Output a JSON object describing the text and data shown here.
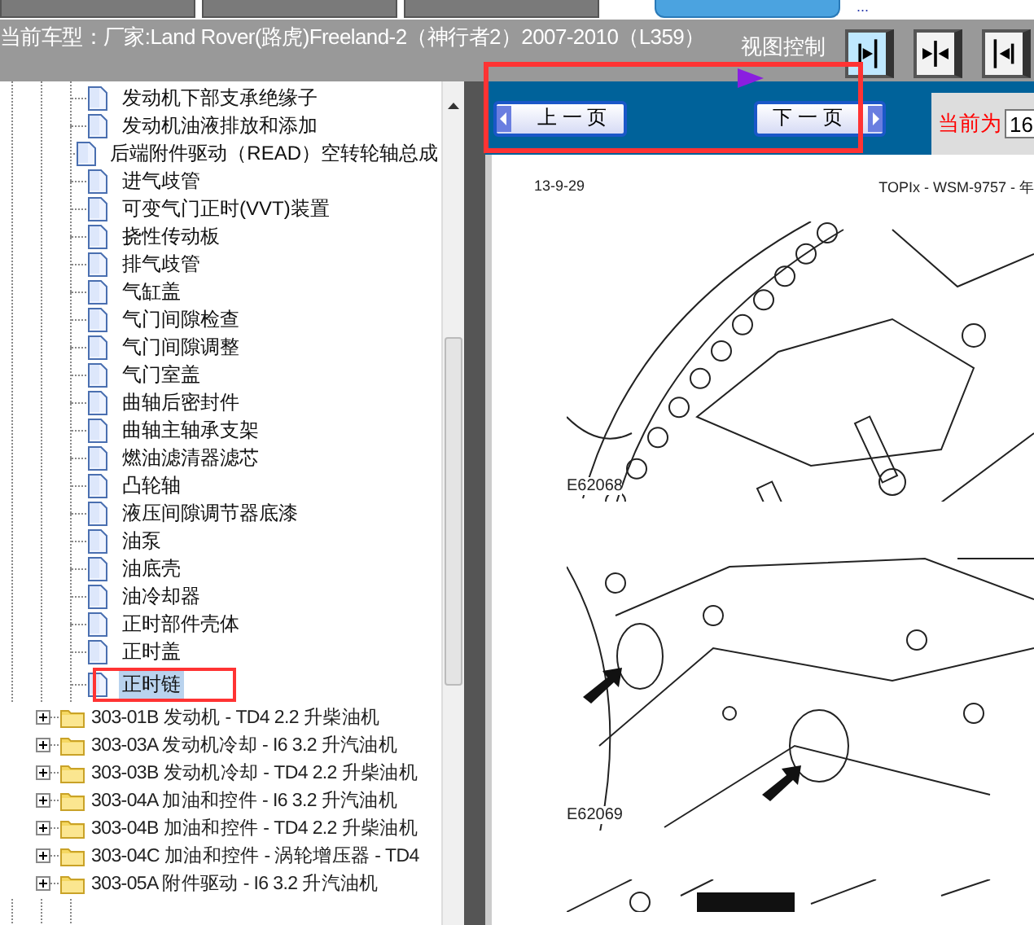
{
  "top_toolbar": {
    "buttons": [
      {
        "kind": "dark"
      },
      {
        "kind": "dark"
      },
      {
        "kind": "dark"
      },
      {
        "kind": "blue"
      }
    ],
    "more": "..."
  },
  "header": {
    "title": "当前车型：厂家:Land Rover(路虎)Freeland-2（神行者2）2007-2010（L359）"
  },
  "view_control": {
    "label": "视图控制",
    "buttons": [
      {
        "kind": "right",
        "selected": true
      },
      {
        "kind": "both",
        "selected": false
      },
      {
        "kind": "left",
        "selected": false
      }
    ]
  },
  "tree": {
    "items": [
      {
        "kind": "page",
        "label": "发动机下部支承绝缘子",
        "selected": false
      },
      {
        "kind": "page",
        "label": "发动机油液排放和添加",
        "selected": false
      },
      {
        "kind": "page",
        "label": "后端附件驱动（READ）空转轮轴总成",
        "selected": false
      },
      {
        "kind": "page",
        "label": "进气歧管",
        "selected": false
      },
      {
        "kind": "page",
        "label": "可变气门正时(VVT)装置",
        "selected": false
      },
      {
        "kind": "page",
        "label": "挠性传动板",
        "selected": false
      },
      {
        "kind": "page",
        "label": "排气歧管",
        "selected": false
      },
      {
        "kind": "page",
        "label": "气缸盖",
        "selected": false
      },
      {
        "kind": "page",
        "label": "气门间隙检查",
        "selected": false
      },
      {
        "kind": "page",
        "label": "气门间隙调整",
        "selected": false
      },
      {
        "kind": "page",
        "label": "气门室盖",
        "selected": false
      },
      {
        "kind": "page",
        "label": "曲轴后密封件",
        "selected": false
      },
      {
        "kind": "page",
        "label": "曲轴主轴承支架",
        "selected": false
      },
      {
        "kind": "page",
        "label": "燃油滤清器滤芯",
        "selected": false
      },
      {
        "kind": "page",
        "label": "凸轮轴",
        "selected": false
      },
      {
        "kind": "page",
        "label": "液压间隙调节器底漆",
        "selected": false
      },
      {
        "kind": "page",
        "label": "油泵",
        "selected": false
      },
      {
        "kind": "page",
        "label": "油底壳",
        "selected": false
      },
      {
        "kind": "page",
        "label": "油冷却器",
        "selected": false
      },
      {
        "kind": "page",
        "label": "正时部件壳体",
        "selected": false
      },
      {
        "kind": "page",
        "label": "正时盖",
        "selected": false
      },
      {
        "kind": "page",
        "label": "正时链",
        "selected": true
      },
      {
        "kind": "folder",
        "label": "303-01B 发动机 - TD4 2.2 升柴油机",
        "expanded": false,
        "selected": false
      },
      {
        "kind": "folder",
        "label": "303-03A 发动机冷却 - I6 3.2 升汽油机",
        "expanded": false,
        "selected": false
      },
      {
        "kind": "folder",
        "label": "303-03B 发动机冷却 - TD4 2.2 升柴油机",
        "expanded": false,
        "selected": false
      },
      {
        "kind": "folder",
        "label": "303-04A 加油和控件 - I6 3.2 升汽油机",
        "expanded": false,
        "selected": false
      },
      {
        "kind": "folder",
        "label": "303-04B 加油和控件 - TD4 2.2 升柴油机",
        "expanded": false,
        "selected": false
      },
      {
        "kind": "folder",
        "label": "303-04C 加油和控件 - 涡轮增压器 - TD4",
        "expanded": false,
        "selected": false
      },
      {
        "kind": "folder",
        "label": "303-05A 附件驱动 - I6 3.2 升汽油机",
        "expanded": false,
        "selected": false
      }
    ]
  },
  "navigation": {
    "prev": "上 一 页",
    "next": "下 一 页",
    "current_label": "当前为",
    "current_value": "16"
  },
  "document": {
    "date": "13-9-29",
    "source": "TOPIx - WSM-9757 - 年",
    "figures": [
      {
        "caption": "E62068",
        "kind": "chain"
      },
      {
        "caption": "E62069",
        "kind": "arrows"
      },
      {
        "kind": "partial"
      }
    ]
  }
}
